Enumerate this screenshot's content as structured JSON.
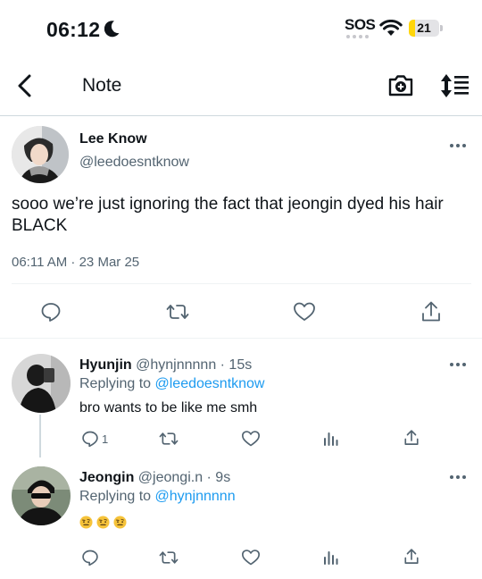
{
  "status_bar": {
    "time": "06:12",
    "sos": "SOS",
    "battery": "21",
    "battery_level": 0.21
  },
  "nav": {
    "title": "Note"
  },
  "tweet": {
    "author_name": "Lee Know",
    "author_handle": "@leedoesntknow",
    "text": "sooo we’re just ignoring the fact that jeongin dyed his hair BLACK",
    "timestamp": "06:11 AM · 23 Mar 25"
  },
  "replies": [
    {
      "name": "Hyunjin",
      "meta": "@hynjnnnnn · 15s",
      "replying_label": "Replying to",
      "replying_to": "@leedoesntknow",
      "text": "bro wants to be like me smh",
      "reply_count": "1"
    },
    {
      "name": "Jeongin",
      "meta": "@jeongi.n · 9s",
      "replying_label": "Replying to",
      "replying_to": "@hynjnnnnn",
      "emojis": [
        "face-with-raised-eyebrow",
        "face-with-raised-eyebrow",
        "face-with-raised-eyebrow"
      ]
    }
  ],
  "colors": {
    "accent": "#1d9bf0",
    "text": "#0f1419",
    "secondary": "#536471",
    "divider": "#eff3f4",
    "battery_fill": "#ffd60a"
  }
}
